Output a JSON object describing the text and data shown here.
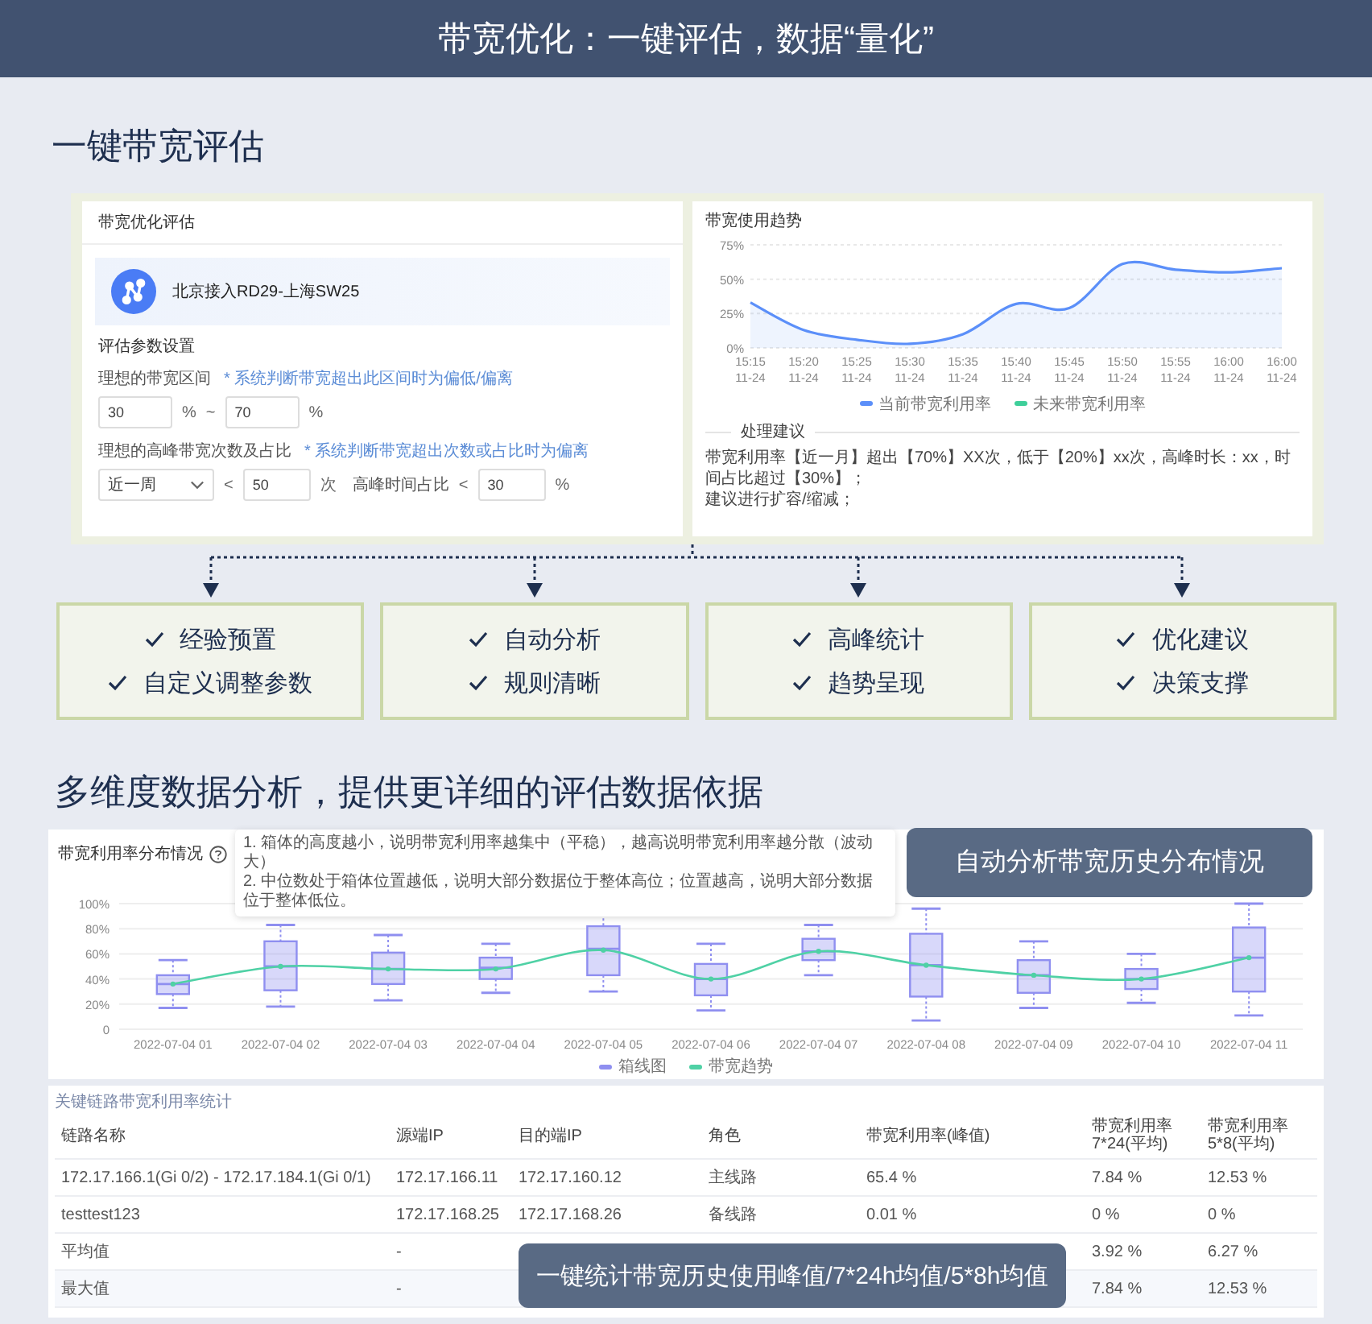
{
  "header": {
    "title": "带宽优化：一键评估，数据“量化”"
  },
  "section_1": {
    "heading": "一键带宽评估"
  },
  "evaluation_card": {
    "title": "带宽优化评估",
    "link_name": "北京接入RD29-上海SW25",
    "params_title": "评估参数设置",
    "range": {
      "label": "理想的带宽区间",
      "hint": "* 系统判断带宽超出此区间时为偏低/偏离",
      "min": "30",
      "min_unit": "%",
      "separator": "~",
      "max": "70",
      "max_unit": "%"
    },
    "peak": {
      "label": "理想的高峰带宽次数及占比",
      "hint": "* 系统判断带宽超出次数或占比时为偏离",
      "period": "近一周",
      "count_op": "<",
      "count": "50",
      "count_unit": "次",
      "ratio_label": "高峰时间占比",
      "ratio_op": "<",
      "ratio": "30",
      "ratio_unit": "%"
    }
  },
  "trend_card": {
    "title": "带宽使用趋势",
    "chart_data": {
      "type": "area",
      "categories": [
        "15:15\n11-24",
        "15:20\n11-24",
        "15:25\n11-24",
        "15:30\n11-24",
        "15:35\n11-24",
        "15:40\n11-24",
        "15:45\n11-24",
        "15:50\n11-24",
        "15:55\n11-24",
        "16:00\n11-24",
        "16:00\n11-24"
      ],
      "ylim": [
        0,
        75
      ],
      "yticks": [
        {
          "value": 0,
          "label": "0%"
        },
        {
          "value": 25,
          "label": "25%"
        },
        {
          "value": 50,
          "label": "50%"
        },
        {
          "value": 75,
          "label": "75%"
        }
      ],
      "series": [
        {
          "name": "当前带宽利用率",
          "color": "#5b8ff9",
          "values": [
            33,
            13,
            6,
            3,
            10,
            32,
            29,
            61,
            57,
            55,
            58
          ]
        },
        {
          "name": "未来带宽利用率",
          "color": "#3ecf9a",
          "values": [
            null,
            null,
            null,
            null,
            null,
            null,
            null,
            null,
            null,
            null,
            null
          ]
        }
      ]
    },
    "advice_title": "处理建议",
    "advice_lines": [
      "带宽利用率【近一月】超出【70%】XX次，低于【20%】xx次，高峰时长：xx，时间占比超过【30%】；",
      "建议进行扩容/缩减；"
    ]
  },
  "features": [
    {
      "lines": [
        "经验预置",
        "自定义调整参数"
      ]
    },
    {
      "lines": [
        "自动分析",
        "规则清晰"
      ]
    },
    {
      "lines": [
        "高峰统计",
        "趋势呈现"
      ]
    },
    {
      "lines": [
        "优化建议",
        "决策支撑"
      ]
    }
  ],
  "section_2": {
    "heading": "多维度数据分析，提供更详细的评估数据依据"
  },
  "distribution_card": {
    "title": "带宽利用率分布情况",
    "tooltip_lines": [
      "1. 箱体的高度越小，说明带宽利用率越集中（平稳），越高说明带宽利用率越分散（波动大）",
      "2. 中位数处于箱体位置越低，说明大部分数据位于整体高位；位置越高，说明大部分数据位于整体低位。"
    ],
    "box_legend": {
      "name": "箱线图",
      "color": "#8f8ff0"
    },
    "chart_data": {
      "type": "line",
      "grid": true,
      "categories": [
        "2022-07-04 01",
        "2022-07-04 02",
        "2022-07-04 03",
        "2022-07-04 04",
        "2022-07-04 05",
        "2022-07-04 06",
        "2022-07-04 07",
        "2022-07-04 08",
        "2022-07-04 09",
        "2022-07-04 10",
        "2022-07-04 11"
      ],
      "ylim": [
        0,
        100
      ],
      "yticks": [
        {
          "value": 0,
          "label": "0"
        },
        {
          "value": 20,
          "label": "20%"
        },
        {
          "value": 40,
          "label": "40%"
        },
        {
          "value": 60,
          "label": "60%"
        },
        {
          "value": 80,
          "label": "80%"
        },
        {
          "value": 100,
          "label": "100%"
        }
      ],
      "series": [
        {
          "name": "带宽趋势",
          "color": "#4fd1a5",
          "marker": true,
          "values": [
            36,
            50,
            48,
            48,
            63,
            40,
            62,
            51,
            43,
            40,
            57
          ]
        }
      ]
    }
  },
  "distribution_callout": "自动分析带宽历史分布情况",
  "stats_table": {
    "title": "关键链路带宽利用率统计",
    "columns": [
      "链路名称",
      "源端IP",
      "目的端IP",
      "角色",
      "带宽利用率(峰值)",
      "带宽利用率7*24(平均)",
      "带宽利用率5*8(平均)"
    ],
    "rows": [
      [
        "172.17.166.1(Gi 0/2) - 172.17.184.1(Gi 0/1)",
        "172.17.166.11",
        "172.17.160.12",
        "主线路",
        "65.4 %",
        "7.84 %",
        "12.53 %"
      ],
      [
        "testtest123",
        "172.17.168.25",
        "172.17.168.26",
        "备线路",
        "0.01 %",
        "0 %",
        "0 %"
      ],
      [
        "平均值",
        "-",
        null,
        null,
        null,
        "3.92 %",
        "6.27 %"
      ],
      [
        "最大值",
        "-",
        null,
        null,
        null,
        "7.84 %",
        "12.53 %"
      ]
    ]
  },
  "stats_callout": "一键统计带宽历史使用峰值/7*24h均值/5*8h均值"
}
